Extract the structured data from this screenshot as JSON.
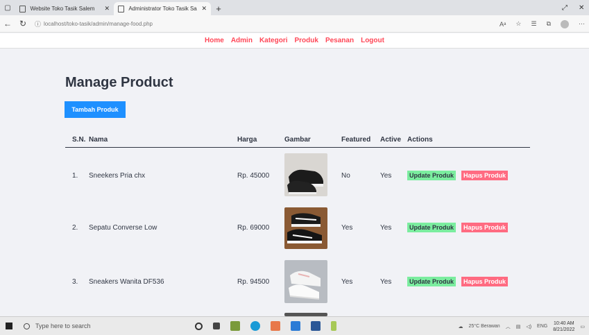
{
  "browser": {
    "tabs": [
      {
        "title": "Website Toko Tasik Salem",
        "active": false
      },
      {
        "title": "Administrator Toko Tasik Salem",
        "active": true
      }
    ],
    "url": "localhost/toko-tasik/admin/manage-food.php"
  },
  "menu": [
    "Home",
    "Admin",
    "Kategori",
    "Produk",
    "Pesanan",
    "Logout"
  ],
  "page": {
    "title": "Manage Product",
    "add_button": "Tambah Produk"
  },
  "table": {
    "headers": [
      "S.N.",
      "Nama",
      "Harga",
      "Gambar",
      "Featured",
      "Active",
      "Actions"
    ],
    "rows": [
      {
        "sn": "1.",
        "name": "Sneekers Pria chx",
        "price": "Rp. 45000",
        "featured": "No",
        "active": "Yes",
        "image": "black-sneakers"
      },
      {
        "sn": "2.",
        "name": "Sepatu Converse Low",
        "price": "Rp. 69000",
        "featured": "Yes",
        "active": "Yes",
        "image": "converse-low"
      },
      {
        "sn": "3.",
        "name": "Sneakers Wanita DF536",
        "price": "Rp. 94500",
        "featured": "Yes",
        "active": "Yes",
        "image": "white-sneakers"
      }
    ],
    "update_label": "Update Produk",
    "delete_label": "Hapus Produk"
  },
  "taskbar": {
    "search_placeholder": "Type here to search",
    "weather": "25°C Berawan",
    "lang": "ENG",
    "time": "10:40 AM",
    "date": "8/21/2022"
  },
  "colors": {
    "accent_red": "#ff4757",
    "primary_blue": "#1e90ff",
    "update_green": "#7bed9f",
    "delete_pink": "#ff6b81",
    "page_bg": "#f1f2f6"
  }
}
